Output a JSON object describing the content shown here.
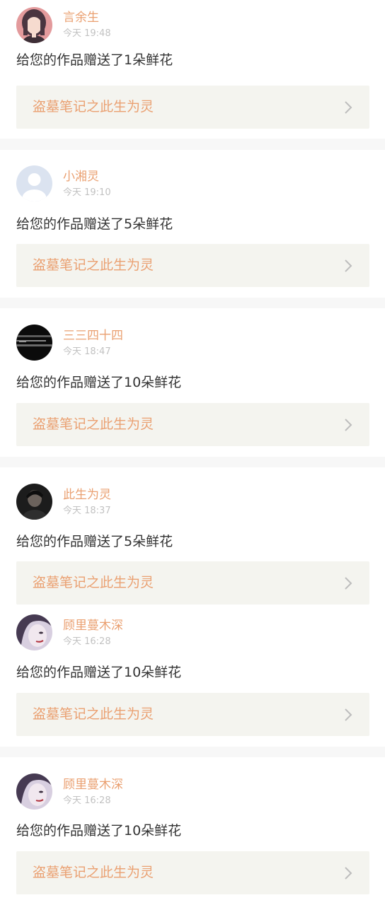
{
  "notifications": [
    {
      "avatar": "girl-anime-avatar",
      "username": "言余生",
      "timestamp": "今天 19:48",
      "message": "给您的作品赠送了1朵鲜花",
      "work_title": "盗墓笔记之此生为灵"
    },
    {
      "avatar": "default-person-avatar",
      "username": "小湘灵",
      "timestamp": "今天 19:10",
      "message": "给您的作品赠送了5朵鲜花",
      "work_title": "盗墓笔记之此生为灵"
    },
    {
      "avatar": "dark-screen-avatar",
      "username": "三三四十四",
      "timestamp": "今天 18:47",
      "message": "给您的作品赠送了10朵鲜花",
      "work_title": "盗墓笔记之此生为灵"
    },
    {
      "avatar": "dark-photo-avatar",
      "username": "此生为灵",
      "timestamp": "今天 18:37",
      "message": "给您的作品赠送了5朵鲜花",
      "work_title": "盗墓笔记之此生为灵"
    },
    {
      "avatar": "purple-hair-avatar",
      "username": "顾里蔓木深",
      "timestamp": "今天 16:28",
      "message": "给您的作品赠送了10朵鲜花",
      "work_title": "盗墓笔记之此生为灵"
    },
    {
      "avatar": "purple-hair-avatar",
      "username": "顾里蔓木深",
      "timestamp": "今天 16:28",
      "message": "给您的作品赠送了10朵鲜花",
      "work_title": "盗墓笔记之此生为灵"
    }
  ],
  "colors": {
    "accent": "#eaa071",
    "timestamp": "#c2c2c2",
    "message": "#333333",
    "link_bg": "#f4f4ef",
    "page_bg": "#f7f7f7",
    "card_bg": "#ffffff"
  }
}
